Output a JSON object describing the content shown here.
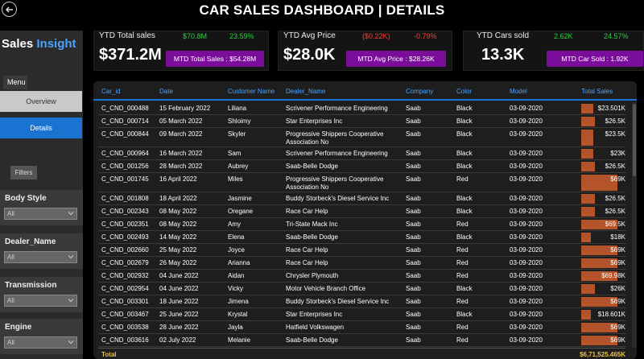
{
  "header": {
    "title": "CAR SALES DASHBOARD | DETAILS"
  },
  "sidebar": {
    "brand_a": "Sales",
    "brand_b": "Insight",
    "menu_label": "Menu",
    "nav": [
      {
        "label": "Overview"
      },
      {
        "label": "Details"
      }
    ],
    "filters_label": "Filters",
    "slicers": [
      {
        "label": "Body Style",
        "value": "All"
      },
      {
        "label": "Dealer_Name",
        "value": "All"
      },
      {
        "label": "Transmission",
        "value": "All"
      },
      {
        "label": "Engine",
        "value": "All"
      }
    ]
  },
  "kpis": [
    {
      "name": "YTD Total sales",
      "value": "$371.2M",
      "delta_abs": "$70.8M",
      "delta_pct": "23.59%",
      "mtd": "MTD Total Sales : $54.28M",
      "delta_color": "#2ecc40"
    },
    {
      "name": "YTD Avg Price",
      "value": "$28.0K",
      "delta_abs": "($0.22K)",
      "delta_pct": "-0.79%",
      "mtd": "MTD Avg Price : $28.26K",
      "delta_color": "#ff3b3b"
    },
    {
      "name": "YTD Cars sold",
      "value": "13.3K",
      "delta_abs": "2.62K",
      "delta_pct": "24.57%",
      "mtd": "MTD Car Sold : 1.92K",
      "delta_color": "#2ecc40"
    }
  ],
  "table": {
    "columns": [
      "Car_id",
      "Date",
      "Customer Name",
      "Dealer_Name",
      "Company",
      "Color",
      "Model",
      "Total Sales"
    ],
    "rows": [
      {
        "id": "C_CND_000488",
        "date": "15 February 2022",
        "customer": "Liliana",
        "dealer": "Scrivener Performance Engineering",
        "company": "Saab",
        "color": "Black",
        "model": "03-09-2020",
        "sales": "$23.501K",
        "ratio": 0.34
      },
      {
        "id": "C_CND_000714",
        "date": "05 March 2022",
        "customer": "Shloimy",
        "dealer": "Star Enterprises Inc",
        "company": "Saab",
        "color": "Black",
        "model": "03-09-2020",
        "sales": "$26.5K",
        "ratio": 0.38
      },
      {
        "id": "C_CND_000844",
        "date": "09 March 2022",
        "customer": "Skyler",
        "dealer": "Progressive Shippers Cooperative Association No",
        "company": "Saab",
        "color": "Black",
        "model": "03-09-2020",
        "sales": "$23.5K",
        "ratio": 0.34
      },
      {
        "id": "C_CND_000964",
        "date": "16 March 2022",
        "customer": "Sam",
        "dealer": "Scrivener Performance Engineering",
        "company": "Saab",
        "color": "Black",
        "model": "03-09-2020",
        "sales": "$23K",
        "ratio": 0.33
      },
      {
        "id": "C_CND_001256",
        "date": "28 March 2022",
        "customer": "Aubrey",
        "dealer": "Saab-Belle Dodge",
        "company": "Saab",
        "color": "Black",
        "model": "03-09-2020",
        "sales": "$26.5K",
        "ratio": 0.38
      },
      {
        "id": "C_CND_001745",
        "date": "16 April 2022",
        "customer": "Miles",
        "dealer": "Progressive Shippers Cooperative Association No",
        "company": "Saab",
        "color": "Red",
        "model": "03-09-2020",
        "sales": "$69K",
        "ratio": 1.0
      },
      {
        "id": "C_CND_001808",
        "date": "18 April 2022",
        "customer": "Jasmine",
        "dealer": "Buddy Storbeck's Diesel Service Inc",
        "company": "Saab",
        "color": "Black",
        "model": "03-09-2020",
        "sales": "$26.5K",
        "ratio": 0.38
      },
      {
        "id": "C_CND_002343",
        "date": "08 May 2022",
        "customer": "Oregane",
        "dealer": "Race Car Help",
        "company": "Saab",
        "color": "Black",
        "model": "03-09-2020",
        "sales": "$26.5K",
        "ratio": 0.38
      },
      {
        "id": "C_CND_002351",
        "date": "08 May 2022",
        "customer": "Amy",
        "dealer": "Tri-State Mack Inc",
        "company": "Saab",
        "color": "Red",
        "model": "03-09-2020",
        "sales": "$69.5K",
        "ratio": 1.0
      },
      {
        "id": "C_CND_002493",
        "date": "14 May 2022",
        "customer": "Elena",
        "dealer": "Saab-Belle Dodge",
        "company": "Saab",
        "color": "Black",
        "model": "03-09-2020",
        "sales": "$18K",
        "ratio": 0.26
      },
      {
        "id": "C_CND_002660",
        "date": "25 May 2022",
        "customer": "Joyce",
        "dealer": "Race Car Help",
        "company": "Saab",
        "color": "Red",
        "model": "03-09-2020",
        "sales": "$69K",
        "ratio": 1.0
      },
      {
        "id": "C_CND_002679",
        "date": "26 May 2022",
        "customer": "Arianna",
        "dealer": "Race Car Help",
        "company": "Saab",
        "color": "Red",
        "model": "03-09-2020",
        "sales": "$69K",
        "ratio": 1.0
      },
      {
        "id": "C_CND_002932",
        "date": "04 June 2022",
        "customer": "Aidan",
        "dealer": "Chrysler Plymouth",
        "company": "Saab",
        "color": "Red",
        "model": "03-09-2020",
        "sales": "$69.98K",
        "ratio": 1.0
      },
      {
        "id": "C_CND_002954",
        "date": "04 June 2022",
        "customer": "Vicky",
        "dealer": "Motor Vehicle Branch Office",
        "company": "Saab",
        "color": "Black",
        "model": "03-09-2020",
        "sales": "$26K",
        "ratio": 0.37
      },
      {
        "id": "C_CND_003301",
        "date": "18 June 2022",
        "customer": "Jimena",
        "dealer": "Buddy Storbeck's Diesel Service Inc",
        "company": "Saab",
        "color": "Red",
        "model": "03-09-2020",
        "sales": "$69K",
        "ratio": 1.0
      },
      {
        "id": "C_CND_003467",
        "date": "25 June 2022",
        "customer": "Krystal",
        "dealer": "Star Enterprises Inc",
        "company": "Saab",
        "color": "Black",
        "model": "03-09-2020",
        "sales": "$18.601K",
        "ratio": 0.27
      },
      {
        "id": "C_CND_003538",
        "date": "28 June 2022",
        "customer": "Jayla",
        "dealer": "Hatfield Volkswagen",
        "company": "Saab",
        "color": "Red",
        "model": "03-09-2020",
        "sales": "$69K",
        "ratio": 1.0
      },
      {
        "id": "C_CND_003616",
        "date": "02 July 2022",
        "customer": "Melanie",
        "dealer": "Saab-Belle Dodge",
        "company": "Saab",
        "color": "Red",
        "model": "03-09-2020",
        "sales": "$69K",
        "ratio": 1.0
      }
    ],
    "total_label": "Total",
    "total_value": "$6,71,525.465K"
  },
  "colors": {
    "accent": "#1a73d1",
    "bar": "#b5542b",
    "mtd": "#7a0e9a",
    "total": "#e8c24a"
  }
}
